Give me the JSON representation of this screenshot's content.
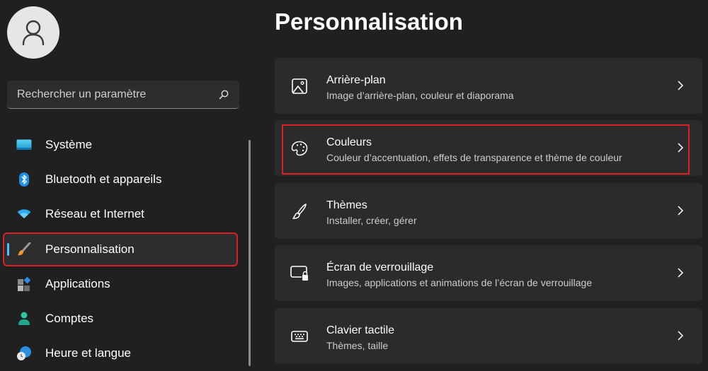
{
  "user": {
    "avatar_icon": "person-icon"
  },
  "search": {
    "placeholder": "Rechercher un paramètre",
    "value": "",
    "icon": "search-icon"
  },
  "sidebar": {
    "items": [
      {
        "label": "Système",
        "icon": "system-display-icon",
        "active": false
      },
      {
        "label": "Bluetooth et appareils",
        "icon": "bluetooth-icon",
        "active": false
      },
      {
        "label": "Réseau et Internet",
        "icon": "wifi-icon",
        "active": false
      },
      {
        "label": "Personnalisation",
        "icon": "paintbrush-icon",
        "active": true
      },
      {
        "label": "Applications",
        "icon": "apps-icon",
        "active": false
      },
      {
        "label": "Comptes",
        "icon": "account-icon",
        "active": false
      },
      {
        "label": "Heure et langue",
        "icon": "time-language-icon",
        "active": false
      }
    ]
  },
  "main": {
    "title": "Personnalisation",
    "cards": [
      {
        "title": "Arrière-plan",
        "subtitle": "Image d’arrière-plan, couleur et diaporama",
        "icon": "image-icon"
      },
      {
        "title": "Couleurs",
        "subtitle": "Couleur d’accentuation, effets de transparence et thème de couleur",
        "icon": "palette-icon",
        "highlighted": true
      },
      {
        "title": "Thèmes",
        "subtitle": "Installer, créer, gérer",
        "icon": "brush-icon"
      },
      {
        "title": "Écran de verrouillage",
        "subtitle": "Images, applications et animations de l’écran de verrouillage",
        "icon": "lock-screen-icon"
      },
      {
        "title": "Clavier tactile",
        "subtitle": "Thèmes, taille",
        "icon": "keyboard-icon"
      }
    ]
  },
  "colors": {
    "background": "#202020",
    "card": "#2b2b2b",
    "accent": "#4cc2ff",
    "highlight_annotation": "#d92027"
  }
}
